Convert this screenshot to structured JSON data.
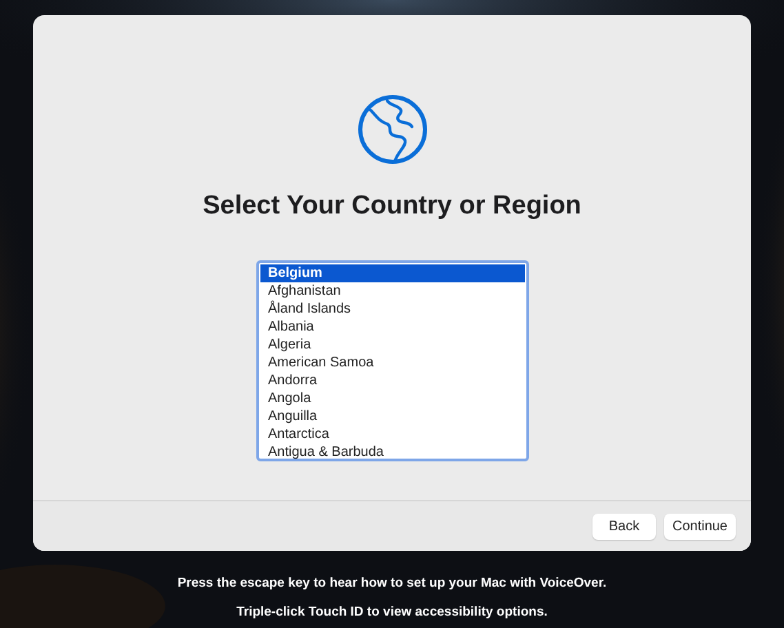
{
  "setup": {
    "title": "Select Your Country or Region",
    "countries": [
      {
        "label": "Belgium",
        "selected": true
      },
      {
        "label": "Afghanistan",
        "selected": false
      },
      {
        "label": "Åland Islands",
        "selected": false
      },
      {
        "label": "Albania",
        "selected": false
      },
      {
        "label": "Algeria",
        "selected": false
      },
      {
        "label": "American Samoa",
        "selected": false
      },
      {
        "label": "Andorra",
        "selected": false
      },
      {
        "label": "Angola",
        "selected": false
      },
      {
        "label": "Anguilla",
        "selected": false
      },
      {
        "label": "Antarctica",
        "selected": false
      },
      {
        "label": "Antigua & Barbuda",
        "selected": false
      }
    ],
    "buttons": [
      {
        "label": "Back",
        "kind": "back"
      },
      {
        "label": "Continue",
        "kind": "continue"
      }
    ]
  },
  "hints": [
    "Press the escape key to hear how to set up your Mac with VoiceOver.",
    "Triple-click Touch ID to view accessibility options."
  ]
}
